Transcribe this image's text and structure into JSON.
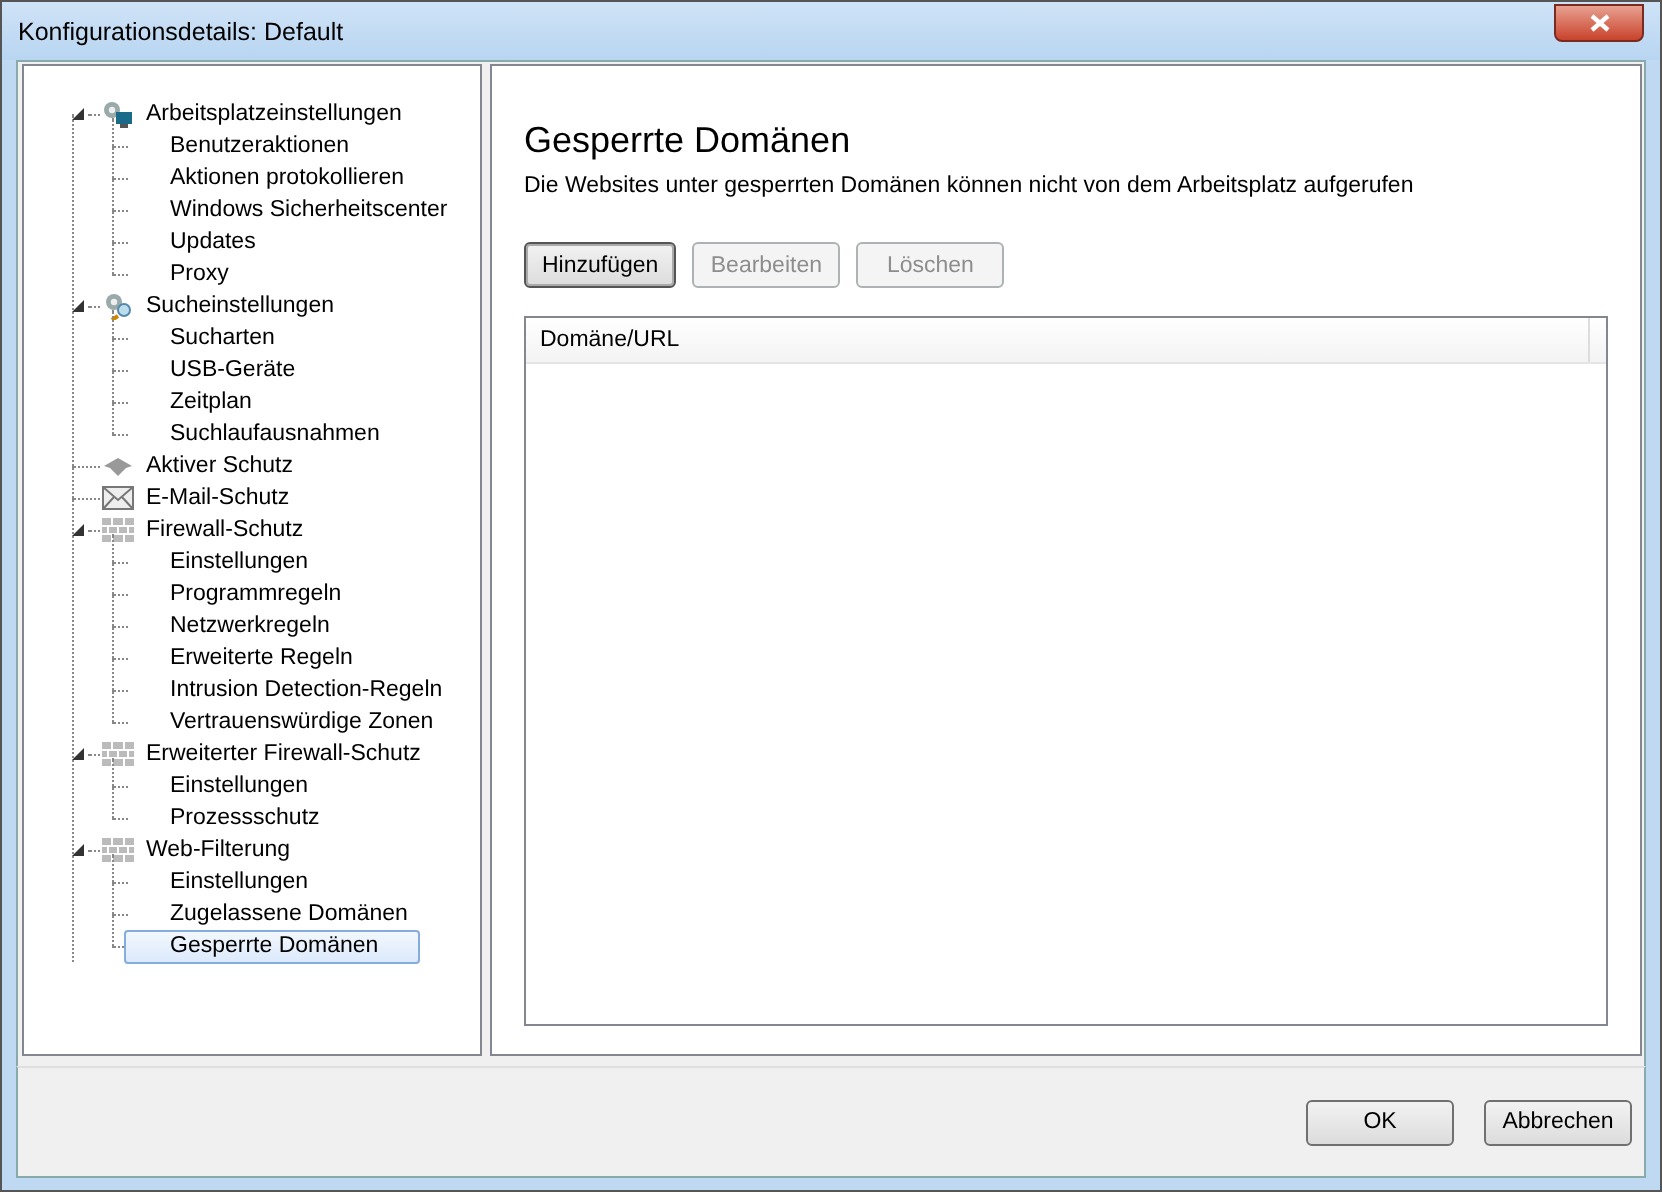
{
  "window": {
    "title": "Konfigurationsdetails: Default"
  },
  "tree": [
    {
      "label": "Arbeitsplatzeinstellungen",
      "kind": "computer",
      "expanded": true,
      "children": [
        {
          "label": "Benutzeraktionen",
          "selected": false
        },
        {
          "label": "Aktionen protokollieren",
          "selected": false
        },
        {
          "label": "Windows Sicherheitscenter",
          "selected": false
        },
        {
          "label": "Updates",
          "selected": false
        },
        {
          "label": "Proxy",
          "selected": false
        }
      ]
    },
    {
      "label": "Sucheinstellungen",
      "kind": "search",
      "expanded": true,
      "children": [
        {
          "label": "Sucharten",
          "selected": false
        },
        {
          "label": "USB-Geräte",
          "selected": false
        },
        {
          "label": "Zeitplan",
          "selected": false
        },
        {
          "label": "Suchlaufausnahmen",
          "selected": false
        }
      ]
    },
    {
      "label": "Aktiver Schutz",
      "kind": "shield",
      "expanded": false
    },
    {
      "label": "E-Mail-Schutz",
      "kind": "mail",
      "expanded": false
    },
    {
      "label": "Firewall-Schutz",
      "kind": "wall",
      "expanded": true,
      "children": [
        {
          "label": "Einstellungen",
          "selected": false
        },
        {
          "label": "Programmregeln",
          "selected": false
        },
        {
          "label": "Netzwerkregeln",
          "selected": false
        },
        {
          "label": "Erweiterte Regeln",
          "selected": false
        },
        {
          "label": "Intrusion Detection-Regeln",
          "selected": false
        },
        {
          "label": "Vertrauenswürdige Zonen",
          "selected": false
        }
      ]
    },
    {
      "label": "Erweiterter Firewall-Schutz",
      "kind": "wall",
      "expanded": true,
      "children": [
        {
          "label": "Einstellungen",
          "selected": false
        },
        {
          "label": "Prozessschutz",
          "selected": false
        }
      ]
    },
    {
      "label": "Web-Filterung",
      "kind": "wall",
      "expanded": true,
      "children": [
        {
          "label": "Einstellungen",
          "selected": false
        },
        {
          "label": "Zugelassene Domänen",
          "selected": false
        },
        {
          "label": "Gesperrte Domänen",
          "selected": true
        }
      ]
    }
  ],
  "page": {
    "title": "Gesperrte Domänen",
    "description": "Die Websites unter gesperrten Domänen können nicht von dem Arbeitsplatz aufgerufen"
  },
  "actions": [
    {
      "label": "Hinzufügen",
      "disabled": false,
      "default": true
    },
    {
      "label": "Bearbeiten",
      "disabled": true,
      "default": false
    },
    {
      "label": "Löschen",
      "disabled": true,
      "default": false
    }
  ],
  "table": {
    "columns": [
      "Domäne/URL"
    ]
  },
  "footer_buttons": [
    "OK",
    "Abbrechen"
  ]
}
